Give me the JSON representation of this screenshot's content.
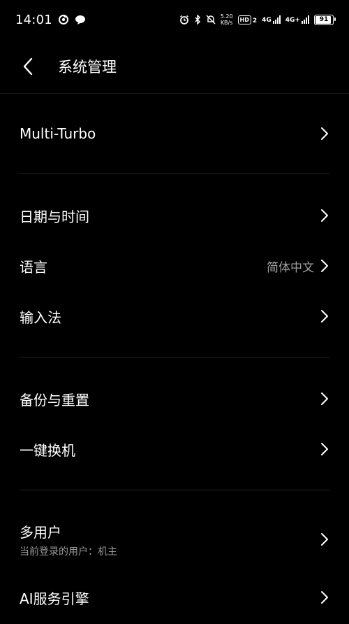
{
  "status": {
    "time": "14:01",
    "speed_value": "5.20",
    "speed_unit": "KB/s",
    "hd_badge": "HD",
    "hd_sub": "2",
    "sim1_net": "4G",
    "sim2_net": "4G+",
    "battery": "91",
    "battery_level": 0.91
  },
  "header": {
    "title": "系统管理"
  },
  "settings": {
    "multi_turbo": {
      "label": "Multi-Turbo"
    },
    "date_time": {
      "label": "日期与时间"
    },
    "language": {
      "label": "语言",
      "value": "简体中文"
    },
    "input_method": {
      "label": "输入法"
    },
    "backup_reset": {
      "label": "备份与重置"
    },
    "phone_clone": {
      "label": "一键换机"
    },
    "multi_user": {
      "label": "多用户",
      "subtitle": "当前登录的用户：机主"
    },
    "ai_engine": {
      "label": "AI服务引擎"
    }
  }
}
